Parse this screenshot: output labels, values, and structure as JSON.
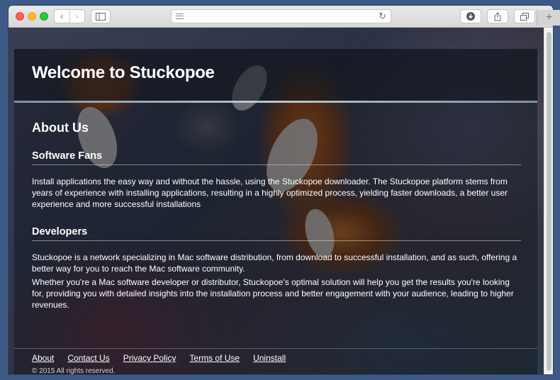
{
  "browser": {
    "back_icon": "‹",
    "forward_icon": "›",
    "reload_icon": "↻",
    "new_tab_icon": "+"
  },
  "site": {
    "title": "Welcome to Stuckopoe"
  },
  "content": {
    "about_heading": "About Us",
    "fans_heading": "Software Fans",
    "fans_text": "Install applications the easy way and without the hassle, using the Stuckopoe downloader. The Stuckopoe platform stems from years of experience with installing applications, resulting in a highly optimized process, yielding faster downloads, a better user experience and more successful installations",
    "dev_heading": "Developers",
    "dev_text_1": "Stuckopoe is a network specializing in Mac software distribution, from download to successful installation, and as such, offering a better way for you to reach the Mac software community.",
    "dev_text_2": "Whether you're a Mac software developer or distributor, Stuckopoe's optimal solution will help you get the results you're looking for, providing you with detailed insights into the installation process and better engagement with your audience, leading to higher revenues."
  },
  "footer": {
    "links": [
      "About",
      "Contact Us",
      "Privacy Policy",
      "Terms of Use",
      "Uninstall"
    ],
    "copyright": "© 2015 All rights reserved."
  }
}
